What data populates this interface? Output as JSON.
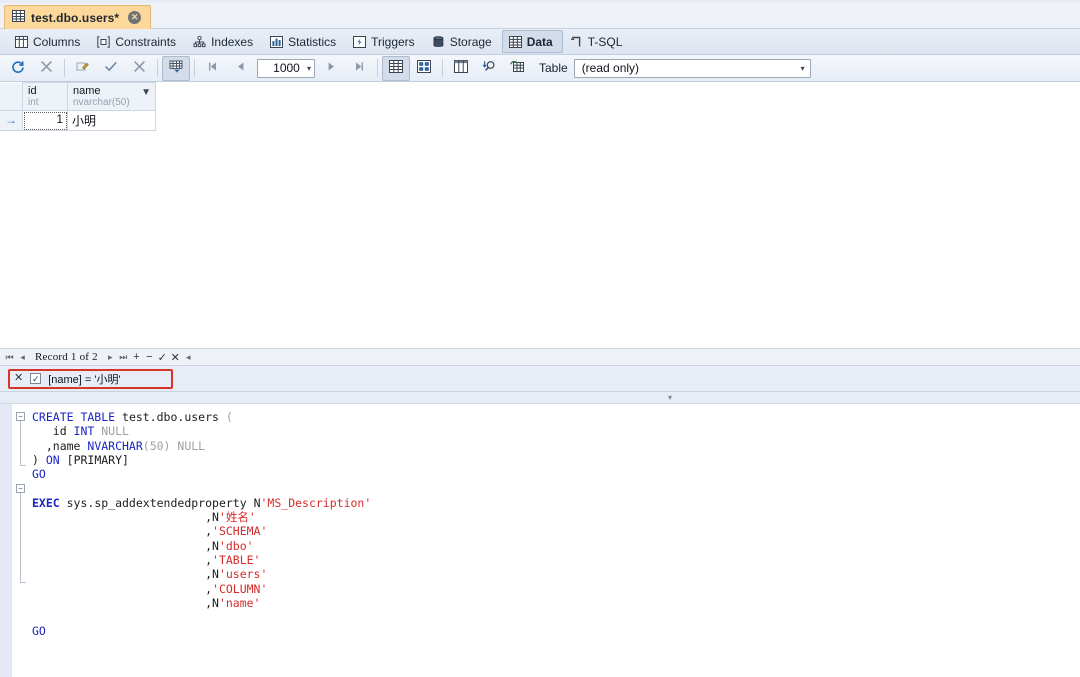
{
  "window": {
    "tab": {
      "title": "test.dbo.users*",
      "icon": "table-icon",
      "close_icon": "close-icon"
    }
  },
  "ribbon": {
    "items": [
      {
        "label": "Columns",
        "icon": "columns-icon",
        "active": false
      },
      {
        "label": "Constraints",
        "icon": "constraints-icon",
        "active": false
      },
      {
        "label": "Indexes",
        "icon": "indexes-icon",
        "active": false
      },
      {
        "label": "Statistics",
        "icon": "statistics-icon",
        "active": false
      },
      {
        "label": "Triggers",
        "icon": "triggers-icon",
        "active": false
      },
      {
        "label": "Storage",
        "icon": "storage-icon",
        "active": false
      },
      {
        "label": "Data",
        "icon": "data-grid-icon",
        "active": true
      },
      {
        "label": "T-SQL",
        "icon": "tsql-icon",
        "active": false
      }
    ]
  },
  "toolbar": {
    "refresh_icon": "refresh-icon",
    "stop_icon": "stop-icon",
    "edit_icon": "edit-row-icon",
    "commit_icon": "commit-check-icon",
    "rollback_icon": "rollback-x-icon",
    "filter_icon": "toggle-filter-icon",
    "first_page_icon": "first-page-icon",
    "prev_page_icon": "prev-page-icon",
    "next_page_icon": "next-page-icon",
    "last_page_icon": "last-page-icon",
    "grid_view_icon": "grid-view-icon",
    "form_view_icon": "form-view-icon",
    "column_view_icon": "column-view-icon",
    "find_icon": "find-icon",
    "export_icon": "export-data-icon",
    "rows_value": "1000",
    "rows_caret": "▾",
    "table_label": "Table",
    "table_value": "(read only)",
    "table_caret": "▾"
  },
  "grid": {
    "columns": [
      {
        "name": "id",
        "type": "int",
        "has_filter": false
      },
      {
        "name": "name",
        "type": "nvarchar(50)",
        "has_filter": true
      }
    ],
    "filter_glyph": "▼",
    "current_row_glyph": "→",
    "rows": [
      {
        "id": "1",
        "name": "小明"
      }
    ]
  },
  "record_nav": {
    "first_icon": "⏮",
    "prev_icon": "◂",
    "text": "Record 1 of 2",
    "next_icon": "▸",
    "last_icon": "⏭",
    "add_icon": "+",
    "delete_icon": "−",
    "post_icon": "✓",
    "cancel_icon": "✕",
    "more_icon": "◂"
  },
  "filter_bar": {
    "clear_icon": "✕",
    "enabled_icon": "✓",
    "expression": "[name] = '小明'",
    "highlight_color": "#d6352b"
  },
  "splitter": {
    "collapse_icon": "▾"
  },
  "sql": {
    "lines": [
      [
        {
          "t": "CREATE TABLE ",
          "c": "kw"
        },
        {
          "t": "test.dbo.users ",
          "c": "plain"
        },
        {
          "t": "(",
          "c": "gray"
        }
      ],
      [
        {
          "t": "   id ",
          "c": "plain"
        },
        {
          "t": "INT ",
          "c": "kw"
        },
        {
          "t": "NULL",
          "c": "gray"
        }
      ],
      [
        {
          "t": "  ,name ",
          "c": "plain"
        },
        {
          "t": "NVARCHAR",
          "c": "kw"
        },
        {
          "t": "(50) ",
          "c": "gray"
        },
        {
          "t": "NULL",
          "c": "gray"
        }
      ],
      [
        {
          "t": ") ",
          "c": "plain"
        },
        {
          "t": "ON ",
          "c": "kw"
        },
        {
          "t": "[PRIMARY]",
          "c": "plain"
        }
      ],
      [
        {
          "t": "GO",
          "c": "go"
        }
      ],
      [
        {
          "t": "",
          "c": "plain"
        }
      ],
      [
        {
          "t": "EXEC ",
          "c": "kw2"
        },
        {
          "t": "sys.sp_addextendedproperty ",
          "c": "plain"
        },
        {
          "t": "N",
          "c": "plain"
        },
        {
          "t": "'MS_Description'",
          "c": "str"
        }
      ],
      [
        {
          "t": "                         ,N",
          "c": "plain"
        },
        {
          "t": "'姓名'",
          "c": "str"
        }
      ],
      [
        {
          "t": "                         ,",
          "c": "plain"
        },
        {
          "t": "'SCHEMA'",
          "c": "str"
        }
      ],
      [
        {
          "t": "                         ,N",
          "c": "plain"
        },
        {
          "t": "'dbo'",
          "c": "str"
        }
      ],
      [
        {
          "t": "                         ,",
          "c": "plain"
        },
        {
          "t": "'TABLE'",
          "c": "str"
        }
      ],
      [
        {
          "t": "                         ,N",
          "c": "plain"
        },
        {
          "t": "'users'",
          "c": "str"
        }
      ],
      [
        {
          "t": "                         ,",
          "c": "plain"
        },
        {
          "t": "'COLUMN'",
          "c": "str"
        }
      ],
      [
        {
          "t": "                         ,N",
          "c": "plain"
        },
        {
          "t": "'name'",
          "c": "str"
        }
      ],
      [
        {
          "t": "",
          "c": "plain"
        }
      ],
      [
        {
          "t": "GO",
          "c": "go"
        }
      ]
    ],
    "fold_glyph": "−"
  },
  "colors": {
    "tab_active": "#fcd99a",
    "ribbon_active": "#d2dceb",
    "accent_blue": "#1f5fa8",
    "keyword": "#1a25c4",
    "string": "#d62b2b",
    "comment_gray": "#a0a0a0",
    "filter_highlight": "#d6352b"
  }
}
